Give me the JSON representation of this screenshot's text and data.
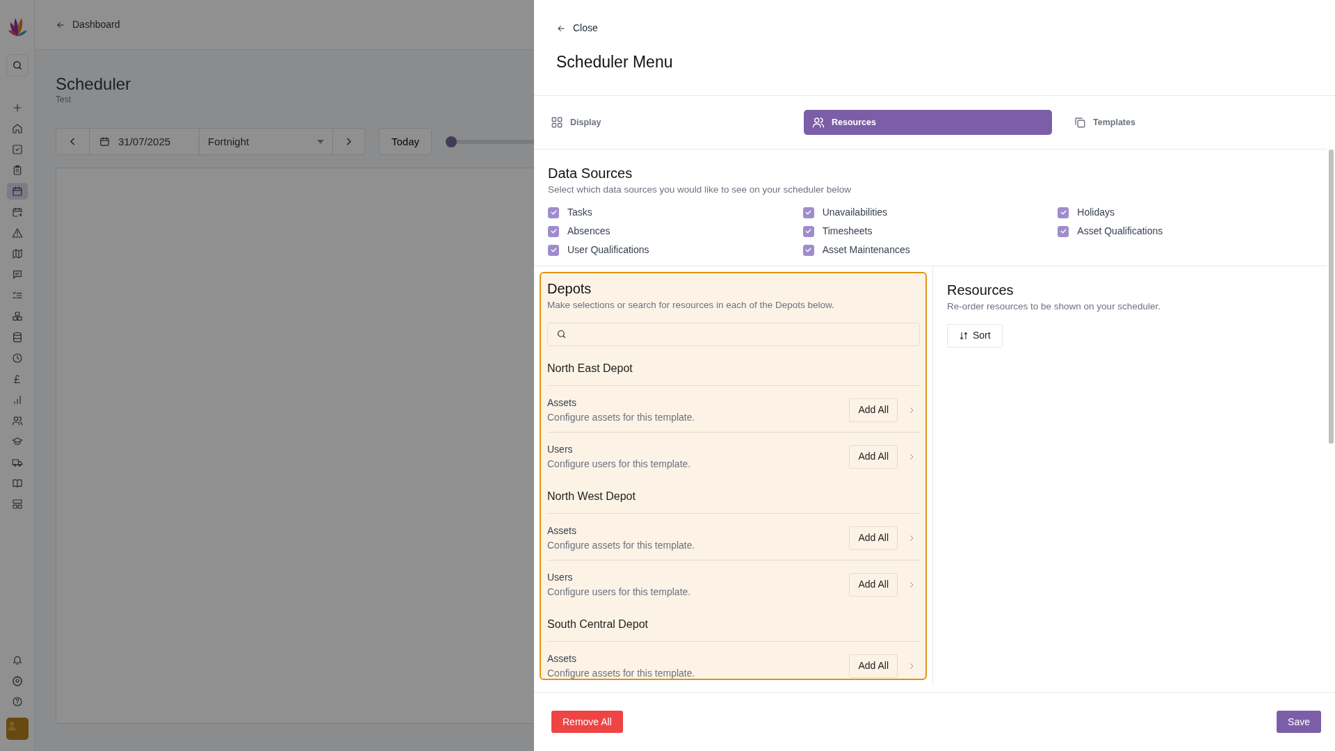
{
  "sidebar": {
    "nav_items": [
      {
        "selected": false
      },
      {
        "selected": false
      },
      {
        "selected": false
      },
      {
        "selected": false
      },
      {
        "selected": true
      },
      {
        "selected": false
      },
      {
        "selected": false
      },
      {
        "selected": false
      },
      {
        "selected": false
      },
      {
        "selected": false
      },
      {
        "selected": false
      },
      {
        "selected": false
      },
      {
        "selected": false
      },
      {
        "selected": false
      },
      {
        "selected": false
      },
      {
        "selected": false
      },
      {
        "selected": false
      },
      {
        "selected": false
      },
      {
        "selected": false
      },
      {
        "selected": false
      }
    ]
  },
  "header": {
    "back_link": "Dashboard"
  },
  "page": {
    "title": "Scheduler",
    "subtitle": "Test"
  },
  "toolbar": {
    "date": "31/07/2025",
    "range": "Fortnight",
    "today_button": "Today",
    "zoom_slider": {
      "level": 0
    }
  },
  "panel": {
    "close_link": "Close",
    "title": "Scheduler Menu",
    "tabs": [
      {
        "label": "Display",
        "selected": false
      },
      {
        "label": "Resources",
        "selected": true
      },
      {
        "label": "Templates",
        "selected": false
      }
    ],
    "data_sources": {
      "title": "Data Sources",
      "description": "Select which data sources you would like to see on your scheduler below",
      "options": [
        {
          "label": "Tasks",
          "checked": true
        },
        {
          "label": "Unavailabilities",
          "checked": true
        },
        {
          "label": "Holidays",
          "checked": true
        },
        {
          "label": "Absences",
          "checked": true
        },
        {
          "label": "Timesheets",
          "checked": true
        },
        {
          "label": "Asset Qualifications",
          "checked": true
        },
        {
          "label": "User Qualifications",
          "checked": true
        },
        {
          "label": "Asset Maintenances",
          "checked": true
        }
      ]
    },
    "depots": {
      "title": "Depots",
      "description": "Make selections or search for resources in each of the Depots below.",
      "groups": [
        {
          "name": "North East Depot",
          "items": [
            {
              "label": "Assets",
              "description": "Configure assets for this template.",
              "button": "Add All"
            },
            {
              "label": "Users",
              "description": "Configure users for this template.",
              "button": "Add All"
            }
          ]
        },
        {
          "name": "North West Depot",
          "items": [
            {
              "label": "Assets",
              "description": "Configure assets for this template.",
              "button": "Add All"
            },
            {
              "label": "Users",
              "description": "Configure users for this template.",
              "button": "Add All"
            }
          ]
        },
        {
          "name": "South Central Depot",
          "items": [
            {
              "label": "Assets",
              "description": "Configure assets for this template.",
              "button": "Add All"
            }
          ]
        }
      ]
    },
    "resources": {
      "title": "Resources",
      "description": "Re-order resources to be shown on your scheduler.",
      "sort_button": "Sort"
    },
    "footer": {
      "remove_button": "Remove All",
      "save_button": "Save"
    }
  }
}
